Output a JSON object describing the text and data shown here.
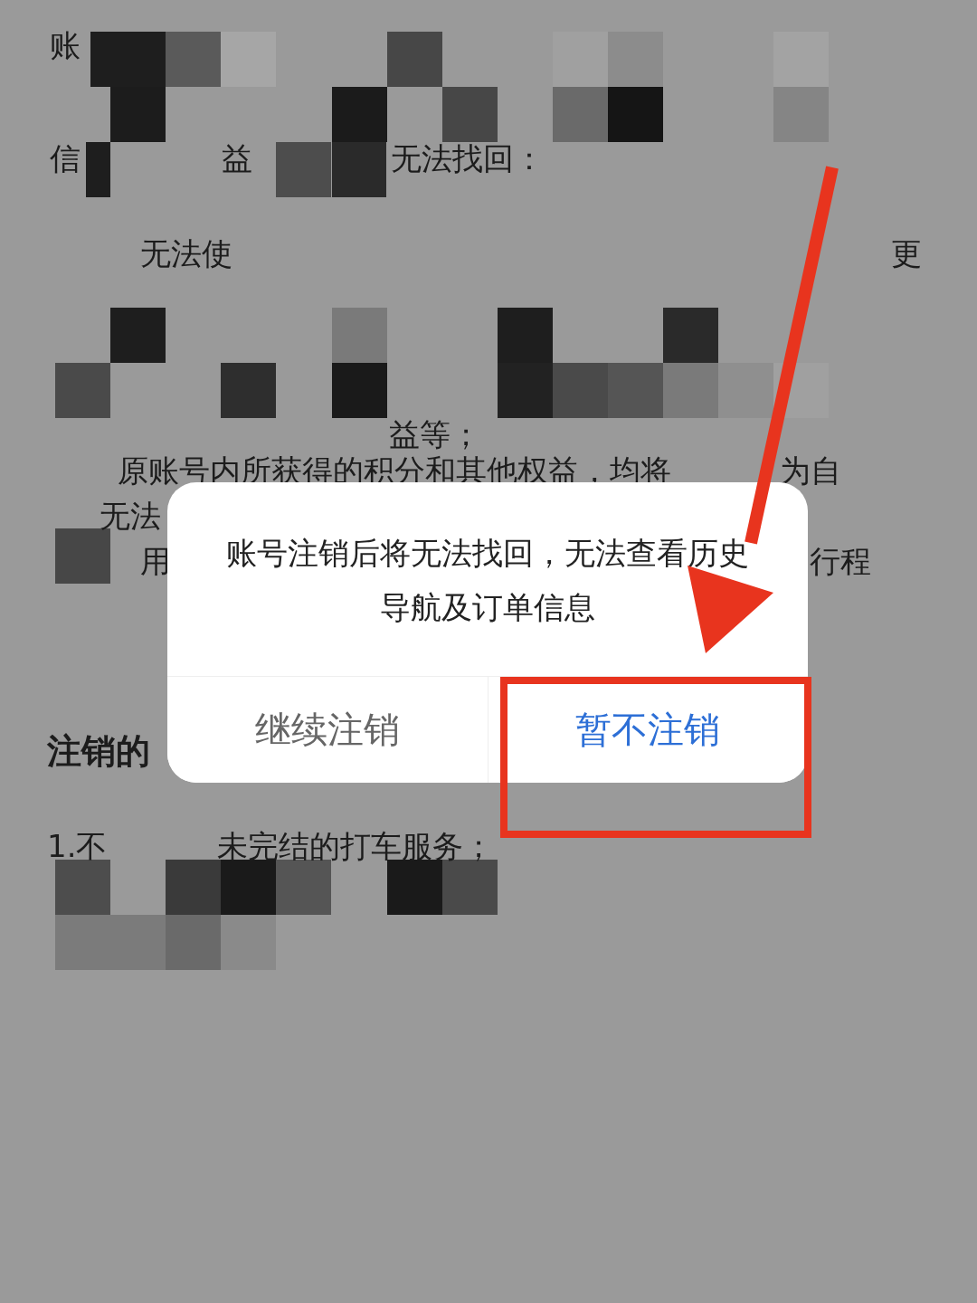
{
  "document": {
    "lines": [
      {
        "kind": "text",
        "fragments": [
          "账"
        ]
      },
      {
        "kind": "text",
        "fragments": [
          "信",
          "益",
          "无法找回："
        ]
      },
      {
        "kind": "text",
        "fragments": [
          "无法使",
          "更"
        ]
      },
      {
        "kind": "text",
        "fragments": [
          "益等；"
        ]
      },
      {
        "kind": "text",
        "fragments": [
          "原账号内所获得的积分和其他权益，均将",
          "为自"
        ]
      },
      {
        "kind": "text",
        "fragments": [
          "无法"
        ]
      },
      {
        "kind": "text",
        "fragments": [
          "用",
          "行程"
        ]
      },
      {
        "kind": "heading",
        "fragments": [
          "注销的"
        ]
      },
      {
        "kind": "text",
        "fragments": [
          "1.不",
          "未完结的打车服务；"
        ]
      }
    ]
  },
  "dialog": {
    "message": "账号注销后将无法找回，无法查看历史导航及订单信息",
    "buttons": [
      {
        "label": "继续注销",
        "kind": "secondary"
      },
      {
        "label": "暂不注销",
        "kind": "primary"
      }
    ]
  }
}
